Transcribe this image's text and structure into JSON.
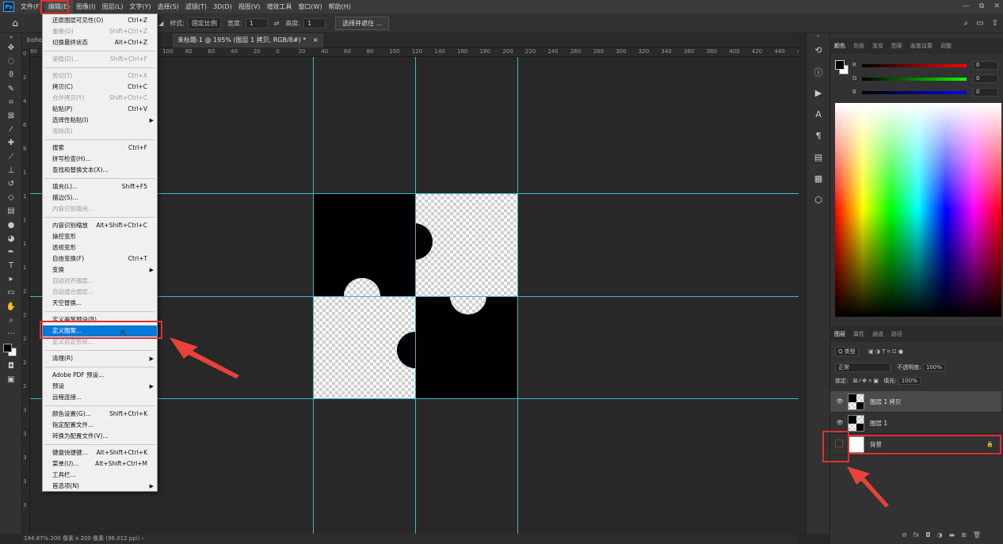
{
  "app": {
    "logo": "Ps"
  },
  "menubar": {
    "items": [
      "文件(F)",
      "编辑(E)",
      "图像(I)",
      "图层(L)",
      "文字(Y)",
      "选择(S)",
      "滤镜(T)",
      "3D(D)",
      "视图(V)",
      "增效工具",
      "窗口(W)",
      "帮助(H)"
    ],
    "window_controls": [
      "—",
      "⧉",
      "✕"
    ]
  },
  "options": {
    "style_label": "样式:",
    "style_value": "固定比例",
    "width_label": "宽度:",
    "width_value": "1",
    "height_label": "高度:",
    "height_value": "1",
    "select_mask_button": "选择并遮住 ..."
  },
  "tabs": {
    "tab1": "boho",
    "tab2": "未标题-1 @ 195% (图层 1 拷贝, RGB/8#) *",
    "tab2_close": "×"
  },
  "ruler": {
    "h_ticks": [
      "80",
      "140",
      "120",
      "100",
      "80",
      "60",
      "40",
      "20",
      "0",
      "20",
      "40",
      "60",
      "80",
      "100",
      "120",
      "140",
      "160",
      "180",
      "200",
      "220",
      "240",
      "260",
      "280",
      "300",
      "320",
      "340",
      "360",
      "380",
      "400",
      "420",
      "440",
      "460"
    ],
    "v_ticks": [
      "0",
      "2",
      "4",
      "6",
      "8",
      "1",
      "1",
      "1",
      "1",
      "1",
      "2",
      "2",
      "2",
      "2",
      "2",
      "3",
      "3",
      "3",
      "3",
      "3"
    ]
  },
  "status": {
    "text": "194.87% 200 像素 x 200 像素 (96.012 ppi)  ›"
  },
  "edit_menu": {
    "items": [
      {
        "label": "还原图层可见性(O)",
        "shortcut": "Ctrl+Z",
        "disabled": false
      },
      {
        "label": "重做(O)",
        "shortcut": "Shift+Ctrl+Z",
        "disabled": true
      },
      {
        "label": "切换最终状态",
        "shortcut": "Alt+Ctrl+Z",
        "disabled": false
      },
      {
        "label": "渐隐(D)...",
        "shortcut": "Shift+Ctrl+F",
        "disabled": true
      },
      {
        "label": "剪切(T)",
        "shortcut": "Ctrl+X",
        "disabled": true
      },
      {
        "label": "拷贝(C)",
        "shortcut": "Ctrl+C",
        "disabled": false
      },
      {
        "label": "合并拷贝(Y)",
        "shortcut": "Shift+Ctrl+C",
        "disabled": true
      },
      {
        "label": "粘贴(P)",
        "shortcut": "Ctrl+V",
        "disabled": false
      },
      {
        "label": "选择性粘贴(I)",
        "shortcut": "",
        "disabled": false,
        "submenu": true
      },
      {
        "label": "清除(E)",
        "shortcut": "",
        "disabled": true
      },
      {
        "label": "搜索",
        "shortcut": "Ctrl+F",
        "disabled": false
      },
      {
        "label": "拼写检查(H)...",
        "shortcut": "",
        "disabled": false
      },
      {
        "label": "查找和替换文本(X)...",
        "shortcut": "",
        "disabled": false
      },
      {
        "label": "填充(L)...",
        "shortcut": "Shift+F5",
        "disabled": false
      },
      {
        "label": "描边(S)...",
        "shortcut": "",
        "disabled": false
      },
      {
        "label": "内容识别填充...",
        "shortcut": "",
        "disabled": true
      },
      {
        "label": "内容识别缩放",
        "shortcut": "Alt+Shift+Ctrl+C",
        "disabled": false
      },
      {
        "label": "操控变形",
        "shortcut": "",
        "disabled": false
      },
      {
        "label": "透视变形",
        "shortcut": "",
        "disabled": false
      },
      {
        "label": "自由变换(F)",
        "shortcut": "Ctrl+T",
        "disabled": false
      },
      {
        "label": "变换",
        "shortcut": "",
        "disabled": false,
        "submenu": true
      },
      {
        "label": "自动对齐图层...",
        "shortcut": "",
        "disabled": true
      },
      {
        "label": "自动混合图层...",
        "shortcut": "",
        "disabled": true
      },
      {
        "label": "天空替换...",
        "shortcut": "",
        "disabled": false
      },
      {
        "label": "定义画笔预设(B)...",
        "shortcut": "",
        "disabled": false
      },
      {
        "label": "定义图案...",
        "shortcut": "",
        "disabled": false,
        "highlight": true
      },
      {
        "label": "定义自定形状...",
        "shortcut": "",
        "disabled": true
      },
      {
        "label": "清理(R)",
        "shortcut": "",
        "disabled": false,
        "submenu": true
      },
      {
        "label": "Adobe PDF 预设...",
        "shortcut": "",
        "disabled": false
      },
      {
        "label": "预设",
        "shortcut": "",
        "disabled": false,
        "submenu": true
      },
      {
        "label": "远程连接...",
        "shortcut": "",
        "disabled": false
      },
      {
        "label": "颜色设置(G)...",
        "shortcut": "Shift+Ctrl+K",
        "disabled": false
      },
      {
        "label": "指定配置文件...",
        "shortcut": "",
        "disabled": false
      },
      {
        "label": "转换为配置文件(V)...",
        "shortcut": "",
        "disabled": false
      },
      {
        "label": "键盘快捷键...",
        "shortcut": "Alt+Shift+Ctrl+K",
        "disabled": false
      },
      {
        "label": "菜单(U)...",
        "shortcut": "Alt+Shift+Ctrl+M",
        "disabled": false
      },
      {
        "label": "工具栏...",
        "shortcut": "",
        "disabled": false
      },
      {
        "label": "首选项(N)",
        "shortcut": "",
        "disabled": false,
        "submenu": true
      }
    ]
  },
  "color_panel": {
    "tabs": [
      "颜色",
      "色板",
      "渐变",
      "图案",
      "画笔设置",
      "调整"
    ],
    "r_label": "R",
    "r_value": "0",
    "g_label": "G",
    "g_value": "0",
    "b_label": "B",
    "b_value": "0"
  },
  "layers_panel": {
    "tabs": [
      "图层",
      "属性",
      "通道",
      "路径"
    ],
    "filter_label": "Q 类型",
    "blend_mode": "正常",
    "opacity_label": "不透明度:",
    "opacity_value": "100%",
    "lock_label": "锁定:",
    "fill_label": "填充:",
    "fill_value": "100%",
    "layers": [
      {
        "name": "图层 1 拷贝",
        "visible": true,
        "selected": true
      },
      {
        "name": "图层 1",
        "visible": true,
        "selected": false
      },
      {
        "name": "背景",
        "visible": false,
        "selected": false,
        "locked": true
      }
    ],
    "footer_icons": [
      "link-icon",
      "fx-icon",
      "mask-icon",
      "adjustment-icon",
      "group-icon",
      "new-layer-icon",
      "trash-icon"
    ]
  },
  "colors": {
    "accent": "#0a78d7",
    "guide": "#3fb7c9",
    "annotation": "#e0302d"
  }
}
